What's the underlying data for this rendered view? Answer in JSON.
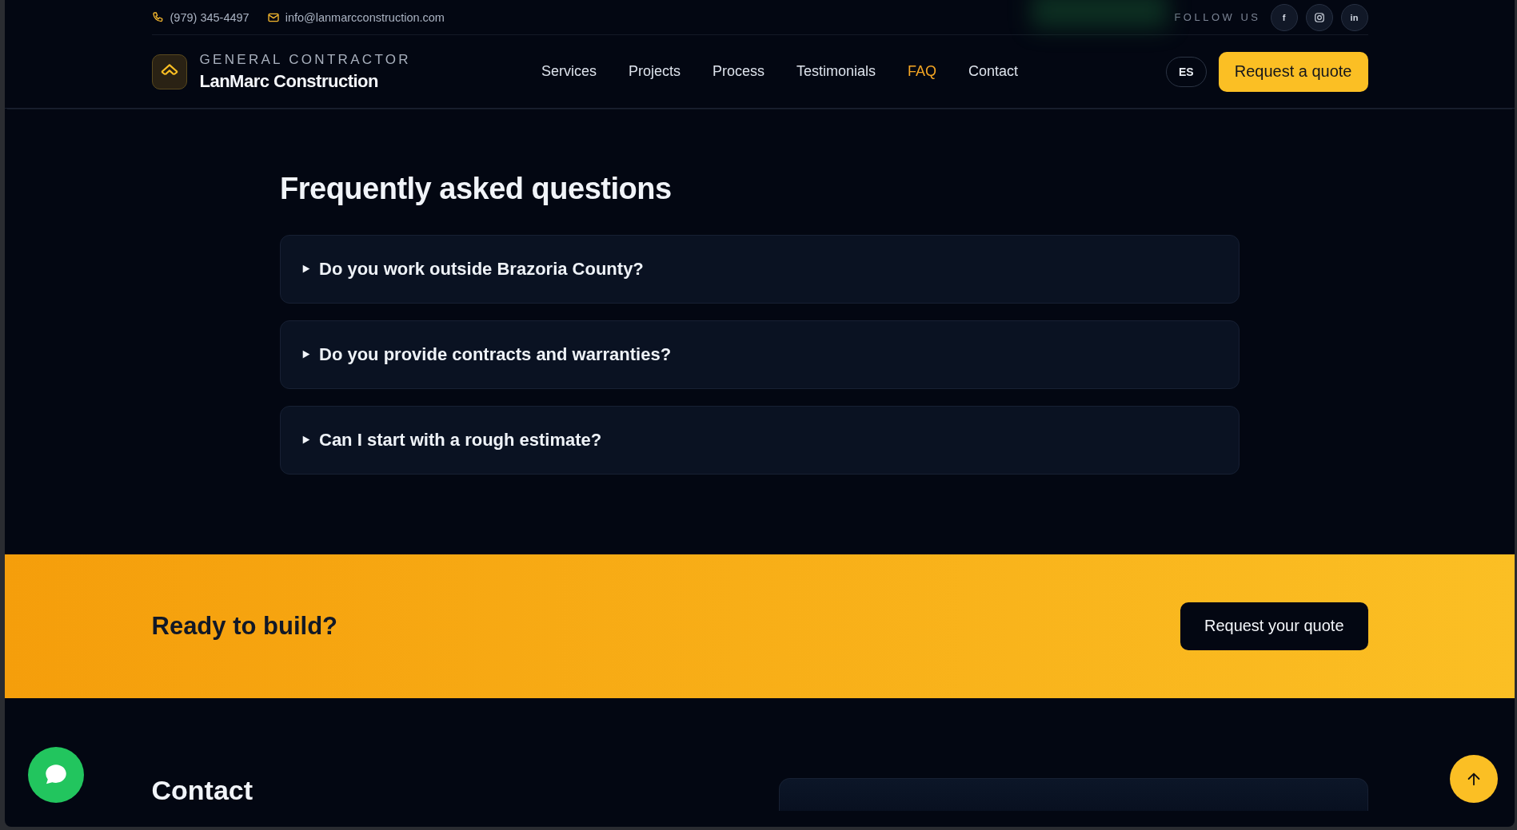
{
  "top_bar": {
    "phone": "(979) 345-4497",
    "email": "info@lanmarcconstruction.com",
    "follow_label": "FOLLOW US",
    "social": [
      {
        "kind": "letter",
        "label": "f"
      },
      {
        "kind": "camera"
      },
      {
        "kind": "letter",
        "label": "in"
      }
    ]
  },
  "header": {
    "tagline": "GENERAL CONTRACTOR",
    "brand": "LanMarc Construction",
    "nav": [
      {
        "label": "Services",
        "selected": false
      },
      {
        "label": "Projects",
        "selected": false
      },
      {
        "label": "Process",
        "selected": false
      },
      {
        "label": "Testimonials",
        "selected": false
      },
      {
        "label": "FAQ",
        "selected": true
      },
      {
        "label": "Contact",
        "selected": false
      }
    ],
    "language": "ES",
    "cta": "Request a quote"
  },
  "faq": {
    "title": "Frequently asked questions",
    "items": [
      {
        "question": "Do you work outside Brazoria County?",
        "expanded": false
      },
      {
        "question": "Do you provide contracts and warranties?",
        "expanded": false
      },
      {
        "question": "Can I start with a rough estimate?",
        "expanded": false
      }
    ]
  },
  "cta_band": {
    "title": "Ready to build?",
    "button": "Request your quote"
  },
  "contact": {
    "title": "Contact"
  }
}
